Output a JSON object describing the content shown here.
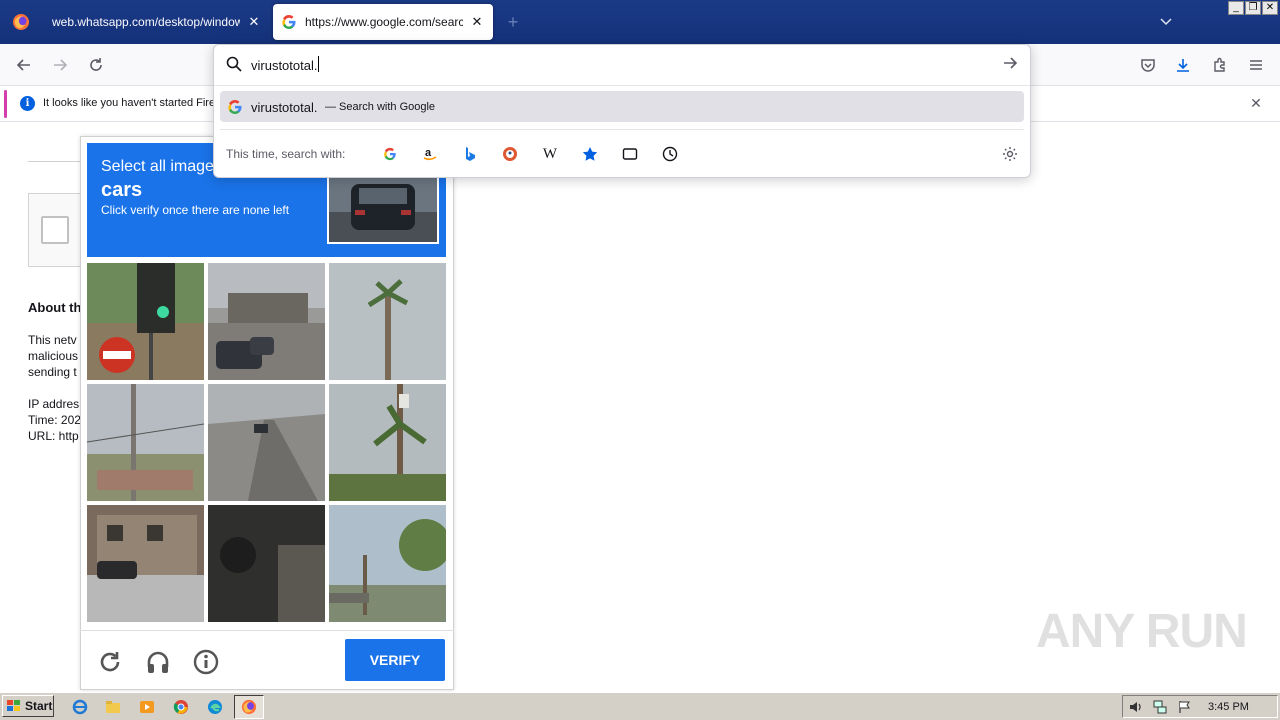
{
  "browser": {
    "tabs": [
      {
        "title": "web.whatsapp.com/desktop/windows/r",
        "close": "✕"
      },
      {
        "title": "https://www.google.com/search?c",
        "close": "✕"
      }
    ],
    "new_tab": "+",
    "window_controls": [
      "_",
      "❐",
      "✕"
    ]
  },
  "url_popup": {
    "input_value": "virustototal.",
    "suggestion": {
      "text": "virustototal.",
      "action": "— Search with Google"
    },
    "oneoff_label": "This time, search with:",
    "engines": [
      "google-icon",
      "amazon-icon",
      "bing-icon",
      "duckduckgo-icon",
      "wikipedia-icon",
      "bookmarks-icon",
      "tabs-icon",
      "history-icon"
    ],
    "wikipedia_glyph": "W"
  },
  "notification": {
    "text": "It looks like you haven't started Fire",
    "icon": "i"
  },
  "page": {
    "about_heading": "About th",
    "body_lines": [
      "This netv",
      "malicious",
      "sending t"
    ],
    "info_lines": [
      "IP addres",
      "Time: 202",
      "URL: http"
    ]
  },
  "captcha": {
    "line1": "Select all image",
    "line2": "cars",
    "line3": "Click verify once there are none left",
    "verify_label": "VERIFY"
  },
  "watermark": "ANY RUN",
  "taskbar": {
    "start_label": "Start",
    "clock": "3:45 PM"
  },
  "colors": {
    "captcha_blue": "#1a73e8",
    "tabbar_blue": "#1b3a86",
    "notification_accent": "#d43eaa",
    "taskbar_gray": "#d4d0c8"
  }
}
